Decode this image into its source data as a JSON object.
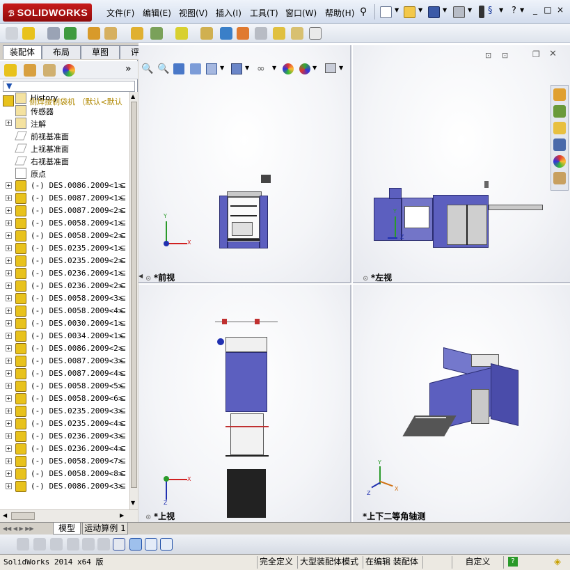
{
  "app": {
    "logo_text": "SOLIDWORKS"
  },
  "menu": [
    "文件(F)",
    "编辑(E)",
    "视图(V)",
    "插入(I)",
    "工具(T)",
    "窗口(W)",
    "帮助(H)"
  ],
  "window_controls": [
    "_",
    "□",
    "×"
  ],
  "command_tabs": [
    "装配体",
    "布局",
    "草图",
    "评估"
  ],
  "tree": {
    "root": "侧焊接制袋机 （默认<默认",
    "fixed_items": [
      "History",
      "传感器",
      "注解",
      "前视基准面",
      "上视基准面",
      "右视基准面",
      "原点"
    ],
    "components": [
      "(-) DES.0086.2009<1>",
      "(-) DES.0087.2009<1>",
      "(-) DES.0087.2009<2>",
      "(-) DES.0058.2009<1>",
      "(-) DES.0058.2009<2>",
      "(-) DES.0235.2009<1>",
      "(-) DES.0235.2009<2>",
      "(-) DES.0236.2009<1>",
      "(-) DES.0236.2009<2>",
      "(-) DES.0058.2009<3>",
      "(-) DES.0058.2009<4>",
      "(-) DES.0030.2009<1>",
      "(-) DES.0034.2009<1>",
      "(-) DES.0086.2009<2>",
      "(-) DES.0087.2009<3>",
      "(-) DES.0087.2009<4>",
      "(-) DES.0058.2009<5>",
      "(-) DES.0058.2009<6>",
      "(-) DES.0235.2009<3>",
      "(-) DES.0235.2009<4>",
      "(-) DES.0236.2009<3>",
      "(-) DES.0236.2009<4>",
      "(-) DES.0058.2009<7>",
      "(-) DES.0058.2009<8>",
      "(-) DES.0086.2009<3>"
    ]
  },
  "viewports": [
    {
      "label": "*前视"
    },
    {
      "label": "*左视"
    },
    {
      "label": "*上视"
    },
    {
      "label": "*上下二等角轴测"
    }
  ],
  "axes": {
    "x": "X",
    "y": "Y",
    "z": "Z"
  },
  "bottom_tabs": [
    "模型",
    "运动算例 1"
  ],
  "status": {
    "version": "SolidWorks 2014 x64 版",
    "defined": "完全定义",
    "mode": "大型装配体模式",
    "editing": "在编辑 装配体",
    "units": "自定义",
    "help": "?"
  },
  "colors": {
    "part_blue": "#5c5fbf",
    "logo_red": "#c81b1b",
    "tree_icon_yellow": "#e8c21c"
  }
}
